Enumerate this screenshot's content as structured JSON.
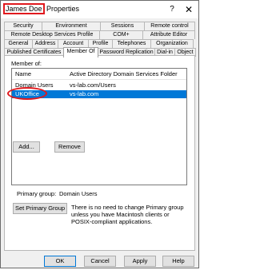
{
  "window": {
    "title_name": "James Doe",
    "title_suffix": " Properties",
    "help": "?",
    "close": "✕"
  },
  "tabs": {
    "row1": [
      "Security",
      "Environment",
      "Sessions",
      "Remote control"
    ],
    "row2": [
      "Remote Desktop Services Profile",
      "COM+",
      "Attribute Editor"
    ],
    "row3": [
      "General",
      "Address",
      "Account",
      "Profile",
      "Telephones",
      "Organization"
    ],
    "row4": [
      "Published Certificates",
      "Member Of",
      "Password Replication",
      "Dial-in",
      "Object"
    ],
    "active": "Member Of"
  },
  "member_of": {
    "label": "Member of:",
    "columns": [
      "Name",
      "Active Directory Domain Services Folder"
    ],
    "rows": [
      {
        "name": "Domain Users",
        "folder": "vs-lab.com/Users"
      },
      {
        "name": "UKOffice",
        "folder": "vs-lab.com"
      }
    ],
    "add_label": "Add...",
    "remove_label": "Remove"
  },
  "primary_group": {
    "label": "Primary group:",
    "value": "Domain Users",
    "set_button": "Set Primary Group",
    "note": "There is no need to change Primary group unless you have Macintosh clients or POSIX-compliant applications."
  },
  "footer": {
    "ok": "OK",
    "cancel": "Cancel",
    "apply": "Apply",
    "help": "Help"
  },
  "colors": {
    "selection": "#0078d7",
    "highlight_marker": "#e0191e"
  }
}
